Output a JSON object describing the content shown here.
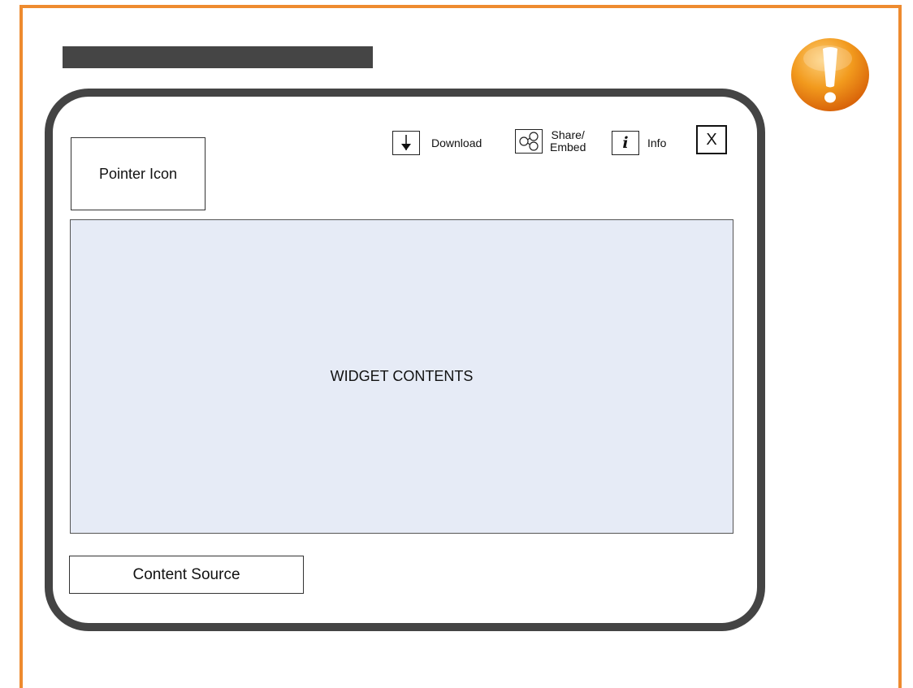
{
  "page": {
    "accent_color": "#ee8b2f",
    "alert_icon": "warning-exclamation-icon"
  },
  "widget": {
    "pointer_label": "Pointer Icon",
    "toolbar": {
      "download_label": "Download",
      "download_icon": "download-arrow-icon",
      "share_label_line1": "Share/",
      "share_label_line2": "Embed",
      "share_icon": "share-nodes-icon",
      "info_label": "Info",
      "info_icon": "info-icon",
      "close_label": "X"
    },
    "contents_label": "WIDGET CONTENTS",
    "content_background": "#e6ebf6",
    "source_label": "Content Source"
  }
}
